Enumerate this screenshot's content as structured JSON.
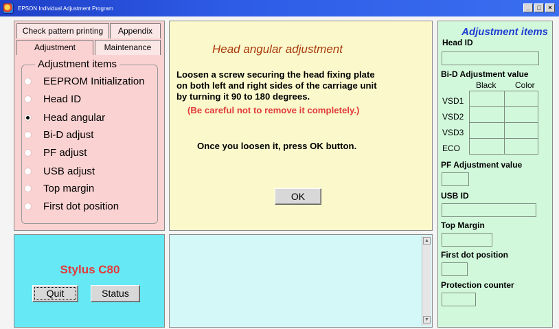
{
  "window": {
    "title": "EPSON Individual Adjustment Program",
    "buttons": [
      "_",
      "□",
      "×"
    ]
  },
  "tabs": [
    {
      "label": "Check pattern printing"
    },
    {
      "label": "Appendix"
    },
    {
      "label": "Adjustment",
      "selected": true
    },
    {
      "label": "Maintenance"
    }
  ],
  "adjustment_items": {
    "title": "Adjustment items",
    "options": [
      {
        "label": "EEPROM Initialization",
        "checked": false
      },
      {
        "label": "Head ID",
        "checked": false
      },
      {
        "label": "Head angular",
        "checked": true
      },
      {
        "label": "Bi-D adjust",
        "checked": false
      },
      {
        "label": "PF adjust",
        "checked": false
      },
      {
        "label": "USB adjust",
        "checked": false
      },
      {
        "label": "Top margin",
        "checked": false
      },
      {
        "label": "First dot position",
        "checked": false
      }
    ]
  },
  "main": {
    "heading": "Head angular adjustment",
    "instruction_lines": [
      "Loosen a screw securing the head fixing plate",
      "on both left and right sides of the carriage unit",
      "by turning it 90 to 180 degrees."
    ],
    "warning": "(Be careful not to remove it completely.)",
    "loosen_text": "Once you loosen it, press OK button.",
    "ok_label": "OK"
  },
  "device": {
    "model": "Stylus C80",
    "quit_label": "Quit",
    "status_label": "Status"
  },
  "log": {
    "scroll_up": "▲",
    "scroll_down": "▼"
  },
  "right_panel": {
    "title": "Adjustment items",
    "head_id_label": "Head ID",
    "bid_label": "Bi-D Adjustment value",
    "bid_columns": [
      "Black",
      "Color"
    ],
    "bid_rows": [
      "VSD1",
      "VSD2",
      "VSD3",
      "ECO"
    ],
    "pf_label": "PF Adjustment value",
    "usb_label": "USB ID",
    "top_margin_label": "Top Margin",
    "first_dot_label": "First dot position",
    "protection_label": "Protection counter"
  },
  "colors": {
    "titlebar": "#2d5be6",
    "adjust_panel": "#fbd2d2",
    "instruction_panel": "#fbf9cc",
    "device_panel": "#66e8f5",
    "log_panel": "#d4f8f8",
    "values_panel": "#d2f8dc",
    "heading": "#a83a0a",
    "warning": "#e03a3a",
    "model_name": "#e33b3b",
    "right_title": "#1f3fd0"
  }
}
